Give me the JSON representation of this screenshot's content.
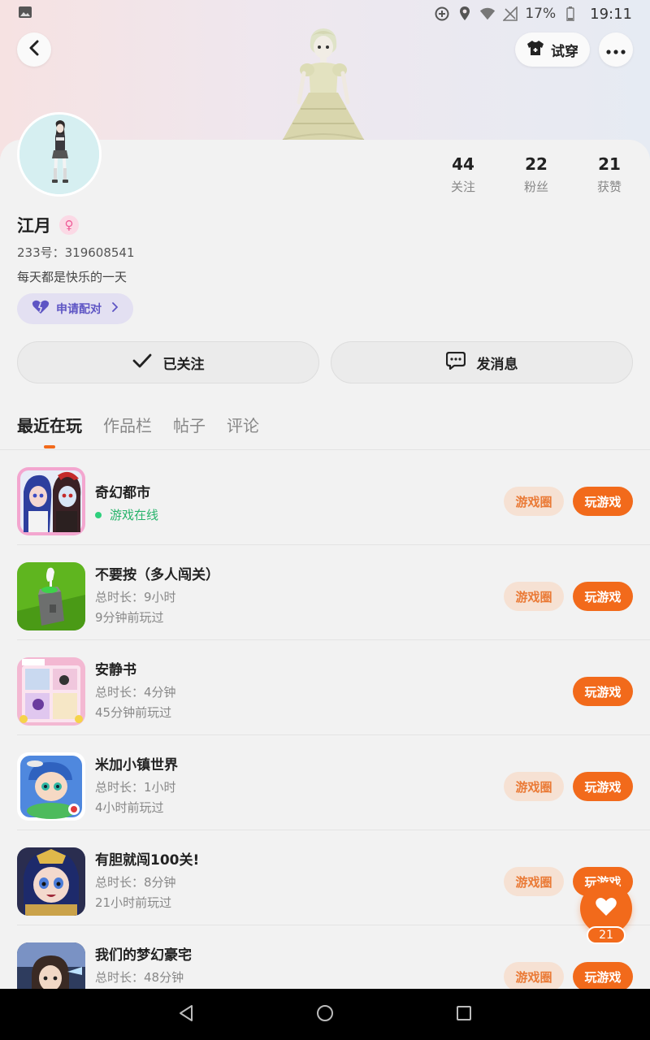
{
  "status_bar": {
    "battery": "17%",
    "time": "19:11"
  },
  "header": {
    "tryon_label": "试穿"
  },
  "profile": {
    "stats": [
      {
        "value": "44",
        "label": "关注"
      },
      {
        "value": "22",
        "label": "粉丝"
      },
      {
        "value": "21",
        "label": "获赞"
      }
    ],
    "username": "江月",
    "gender_symbol": "♀",
    "user_id": "233号：319608541",
    "bio": "每天都是快乐的一天",
    "pair_label": "申请配对"
  },
  "actions": {
    "follow_label": "已关注",
    "message_label": "发消息"
  },
  "tabs": [
    "最近在玩",
    "作品栏",
    "帖子",
    "评论"
  ],
  "games": [
    {
      "title": "奇幻都市",
      "online": "游戏在线",
      "circle": "游戏圈",
      "play": "玩游戏"
    },
    {
      "title": "不要按（多人闯关）",
      "duration": "总时长：9小时",
      "last": "9分钟前玩过",
      "circle": "游戏圈",
      "play": "玩游戏"
    },
    {
      "title": "安静书",
      "duration": "总时长：4分钟",
      "last": "45分钟前玩过",
      "play": "玩游戏"
    },
    {
      "title": "米加小镇世界",
      "duration": "总时长：1小时",
      "last": "4小时前玩过",
      "circle": "游戏圈",
      "play": "玩游戏"
    },
    {
      "title": "有胆就闯100关!",
      "duration": "总时长：8分钟",
      "last": "21小时前玩过",
      "circle": "游戏圈",
      "play": "玩游戏"
    },
    {
      "title": "我们的梦幻豪宅",
      "duration": "总时长：48分钟",
      "circle": "游戏圈",
      "play": "玩游戏"
    }
  ],
  "floating": {
    "like_count": "21"
  },
  "colors": {
    "accent": "#f26a1b",
    "accent_soft": "#f6e1d3",
    "online": "#27b36b",
    "pair_purple": "#5e55c4"
  }
}
